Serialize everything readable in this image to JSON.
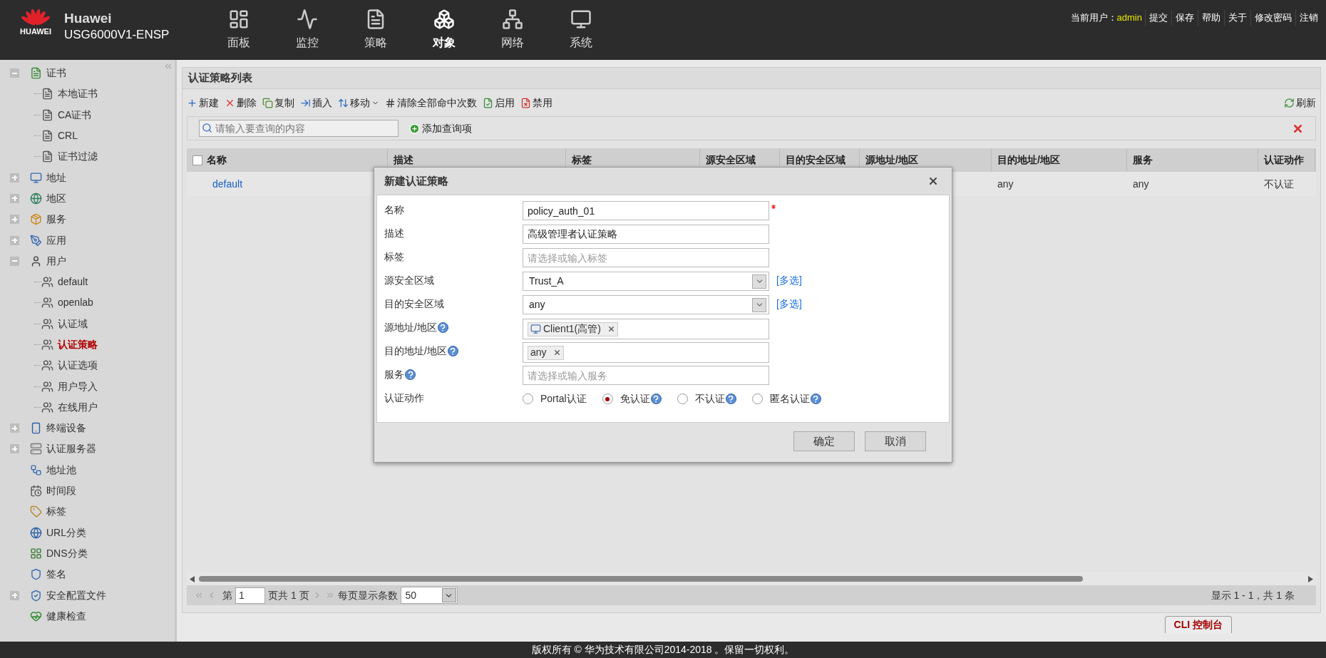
{
  "header": {
    "logo_text": "HUAWEI",
    "brand": "Huawei",
    "model": "USG6000V1-ENSP",
    "nav": [
      {
        "label": "面板",
        "selected": false
      },
      {
        "label": "监控",
        "selected": false
      },
      {
        "label": "策略",
        "selected": false
      },
      {
        "label": "对象",
        "selected": true
      },
      {
        "label": "网络",
        "selected": false
      },
      {
        "label": "系统",
        "selected": false
      }
    ],
    "user_label": "当前用户：",
    "user": "admin",
    "links": [
      "提交",
      "保存",
      "帮助",
      "关于",
      "修改密码",
      "注销"
    ]
  },
  "sidebar": {
    "items": [
      {
        "label": "证书",
        "kind": "group",
        "expanded": true,
        "selected": false,
        "children": [
          {
            "label": "本地证书",
            "selected": false
          },
          {
            "label": "CA证书",
            "selected": false
          },
          {
            "label": "CRL",
            "selected": false
          },
          {
            "label": "证书过滤",
            "selected": false
          }
        ]
      },
      {
        "label": "地址",
        "kind": "group",
        "expanded": false,
        "selected": false
      },
      {
        "label": "地区",
        "kind": "group",
        "expanded": false,
        "selected": false
      },
      {
        "label": "服务",
        "kind": "group",
        "expanded": false,
        "selected": false
      },
      {
        "label": "应用",
        "kind": "group",
        "expanded": false,
        "selected": false
      },
      {
        "label": "用户",
        "kind": "group",
        "expanded": true,
        "selected": false,
        "children": [
          {
            "label": "default",
            "selected": false
          },
          {
            "label": "openlab",
            "selected": false
          },
          {
            "label": "认证域",
            "selected": false
          },
          {
            "label": "认证策略",
            "selected": true
          },
          {
            "label": "认证选项",
            "selected": false
          },
          {
            "label": "用户导入",
            "selected": false
          },
          {
            "label": "在线用户",
            "selected": false
          }
        ]
      },
      {
        "label": "终端设备",
        "kind": "group",
        "expanded": false,
        "selected": false
      },
      {
        "label": "认证服务器",
        "kind": "group",
        "expanded": false,
        "selected": false
      },
      {
        "label": "地址池",
        "kind": "leaf",
        "selected": false
      },
      {
        "label": "时间段",
        "kind": "leaf",
        "selected": false
      },
      {
        "label": "标签",
        "kind": "leaf",
        "selected": false
      },
      {
        "label": "URL分类",
        "kind": "leaf",
        "selected": false
      },
      {
        "label": "DNS分类",
        "kind": "leaf",
        "selected": false
      },
      {
        "label": "签名",
        "kind": "leaf",
        "selected": false
      },
      {
        "label": "安全配置文件",
        "kind": "group",
        "expanded": false,
        "selected": false
      },
      {
        "label": "健康检查",
        "kind": "leaf",
        "selected": false
      }
    ]
  },
  "panel": {
    "title": "认证策略列表",
    "toolbar": [
      "新建",
      "删除",
      "复制",
      "插入",
      "移动",
      "清除全部命中次数",
      "启用",
      "禁用"
    ],
    "refresh": "刷新",
    "search": {
      "placeholder": "请输入要查询的内容"
    },
    "add_query": "添加查询项",
    "table": {
      "select_all_checked": false,
      "columns": [
        "名称",
        "描述",
        "标签",
        "源安全区域",
        "目的安全区域",
        "源地址/地区",
        "目的地址/地区",
        "服务",
        "认证动作"
      ],
      "rows": [
        {
          "name": "default",
          "dest_address": "any",
          "service": "any",
          "action": "不认证"
        }
      ]
    },
    "pager": {
      "page_label": "第",
      "page": "1",
      "total_label": "页共 1 页",
      "per_page_label": "每页显示条数",
      "per_page": "50",
      "summary": "显示 1 - 1，共 1 条"
    }
  },
  "dialog": {
    "title": "新建认证策略",
    "fields": [
      {
        "label": "名称",
        "kind": "text",
        "value": "policy_auth_01",
        "required": true,
        "help": false
      },
      {
        "label": "描述",
        "kind": "text",
        "value": "高级管理者认证策略",
        "required": false,
        "help": false
      },
      {
        "label": "标签",
        "kind": "text",
        "placeholder": "请选择或输入标签",
        "required": false,
        "help": false
      },
      {
        "label": "源安全区域",
        "kind": "select",
        "value": "Trust_A",
        "link": "[多选]",
        "required": false,
        "help": false
      },
      {
        "label": "目的安全区域",
        "kind": "select",
        "value": "any",
        "link": "[多选]",
        "required": false,
        "help": false
      },
      {
        "label": "源地址/地区",
        "kind": "tags",
        "required": false,
        "help": true,
        "tags": [
          {
            "label": "Client1(高管)",
            "kind": "host"
          }
        ]
      },
      {
        "label": "目的地址/地区",
        "kind": "tags",
        "required": false,
        "help": true,
        "tags": [
          {
            "label": "any",
            "kind": "plain"
          }
        ]
      },
      {
        "label": "服务",
        "kind": "text",
        "placeholder": "请选择或输入服务",
        "required": false,
        "help": true
      },
      {
        "label": "认证动作",
        "kind": "radio",
        "required": false,
        "help": false,
        "options": [
          {
            "label": "Portal认证",
            "selected": false,
            "help": false
          },
          {
            "label": "免认证",
            "selected": true,
            "help": true
          },
          {
            "label": "不认证",
            "selected": false,
            "help": true
          },
          {
            "label": "匿名认证",
            "selected": false,
            "help": true
          }
        ]
      }
    ],
    "buttons": [
      "确定",
      "取消"
    ]
  },
  "cli_tab": "CLI 控制台",
  "copyright": "版权所有 © 华为技术有限公司2014-2018 。保留一切权利。"
}
